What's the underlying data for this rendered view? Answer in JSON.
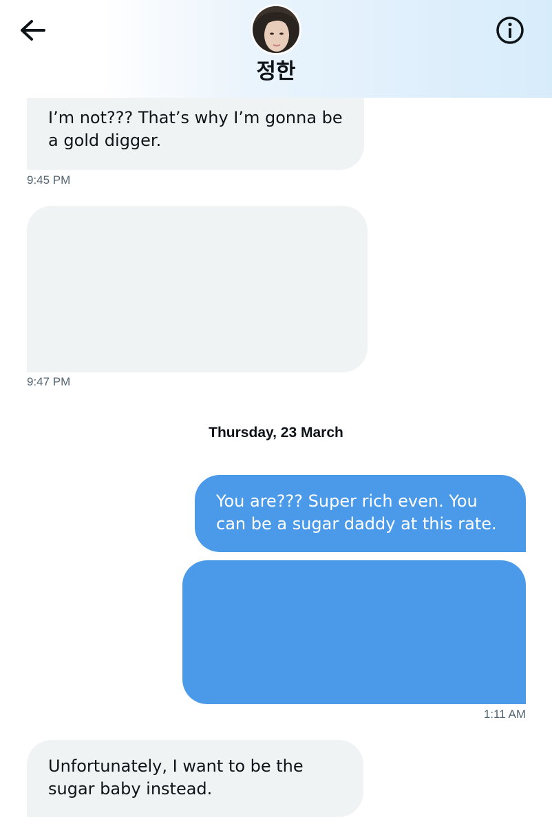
{
  "header": {
    "title": "정한",
    "back_icon": "arrow-left-icon",
    "info_icon": "info-circle-icon"
  },
  "messages": [
    {
      "text": "I’m not??? That’s why I’m gonna be a gold digger.",
      "time": "9:45 PM",
      "direction": "incoming"
    },
    {
      "text": "",
      "time": "9:47 PM",
      "direction": "incoming",
      "redacted": true
    },
    {
      "text": "You are??? Super rich even. You can be a sugar daddy at this rate.",
      "direction": "outgoing"
    },
    {
      "text": "",
      "time": "1:11 AM",
      "direction": "outgoing",
      "redacted": true
    },
    {
      "text": "Unfortunately, I want to be the sugar baby instead.",
      "direction": "incoming"
    }
  ],
  "date_separator": "Thursday, 23 March",
  "colors": {
    "incoming_bubble": "#eff3f4",
    "outgoing_bubble": "#4a9ae9",
    "timestamp": "#536471"
  }
}
